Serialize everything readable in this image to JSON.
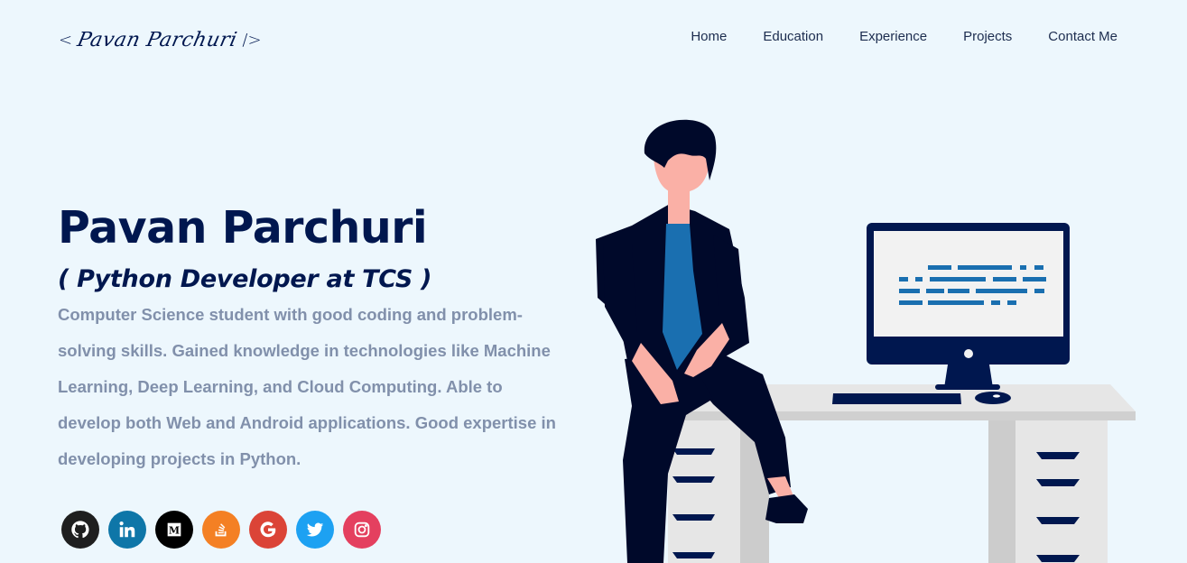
{
  "header": {
    "logo": {
      "open": "<",
      "text": "Pavan Parchuri",
      "close": "/>"
    },
    "nav": [
      {
        "label": "Home"
      },
      {
        "label": "Education"
      },
      {
        "label": "Experience"
      },
      {
        "label": "Projects"
      },
      {
        "label": "Contact Me"
      }
    ]
  },
  "intro": {
    "name": "Pavan Parchuri",
    "role": "( Python Developer at TCS )",
    "bio": "Computer Science student with good coding and problem-solving skills. Gained knowledge in technologies like Machine Learning, Deep Learning, and Cloud Computing. Able to develop both Web and Android applications. Good expertise in developing projects in Python."
  },
  "socials": [
    {
      "icon": "github-icon",
      "color": "#1f1f1f"
    },
    {
      "icon": "linkedin-icon",
      "color": "#0e76a8"
    },
    {
      "icon": "medium-icon",
      "color": "#000000"
    },
    {
      "icon": "stackoverflow-icon",
      "color": "#f48024"
    },
    {
      "icon": "google-icon",
      "color": "#db4437"
    },
    {
      "icon": "twitter-icon",
      "color": "#1da1f2"
    },
    {
      "icon": "instagram-icon",
      "color": "#e4405f"
    }
  ],
  "colors": {
    "background": "#edf7fd",
    "primary": "#00174f",
    "muted_text": "#8190ab",
    "accent_blue": "#1a6fb0"
  }
}
